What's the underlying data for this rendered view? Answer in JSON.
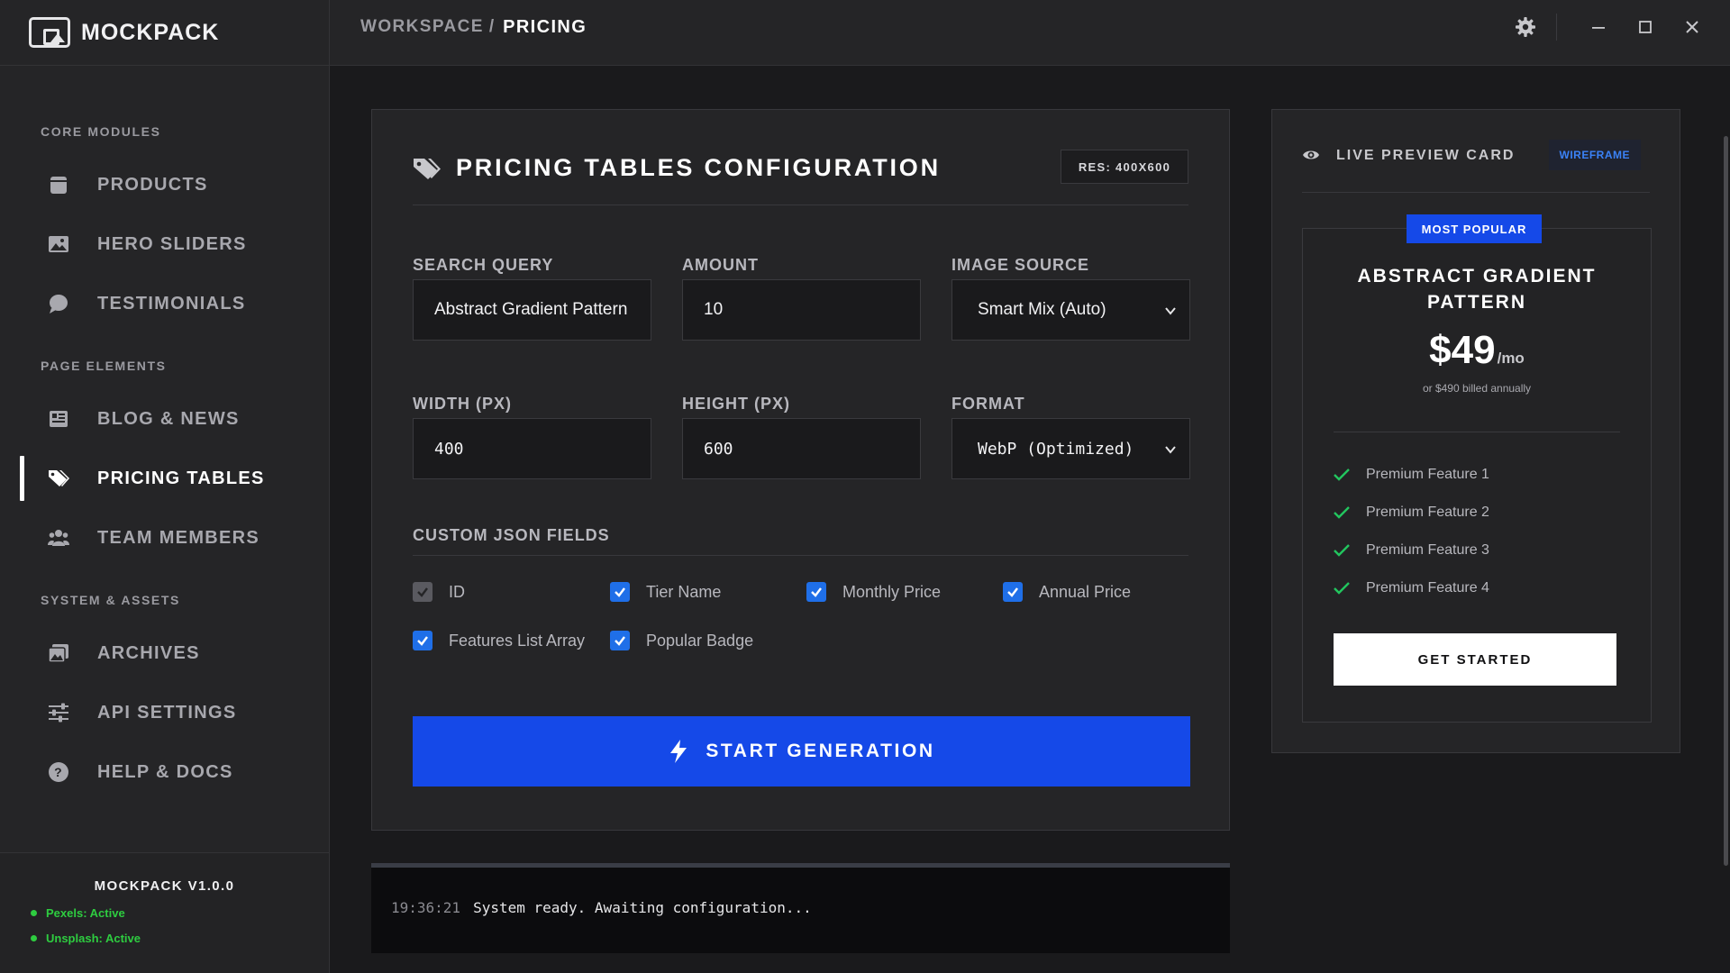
{
  "app": {
    "name": "MOCKPACK",
    "version": "MOCKPACK V1.0.0"
  },
  "sidebar": {
    "sections": [
      {
        "title": "CORE MODULES",
        "items": [
          {
            "label": "PRODUCTS",
            "icon": "box-icon"
          },
          {
            "label": "HERO SLIDERS",
            "icon": "image-icon"
          },
          {
            "label": "TESTIMONIALS",
            "icon": "chat-bubble-icon"
          }
        ]
      },
      {
        "title": "PAGE ELEMENTS",
        "items": [
          {
            "label": "BLOG & NEWS",
            "icon": "newspaper-icon"
          },
          {
            "label": "PRICING TABLES",
            "icon": "tags-icon",
            "active": true
          },
          {
            "label": "TEAM MEMBERS",
            "icon": "users-icon"
          }
        ]
      },
      {
        "title": "SYSTEM & ASSETS",
        "items": [
          {
            "label": "ARCHIVES",
            "icon": "images-icon"
          },
          {
            "label": "API SETTINGS",
            "icon": "sliders-icon"
          },
          {
            "label": "HELP & DOCS",
            "icon": "help-circle-icon"
          }
        ]
      }
    ],
    "status": [
      {
        "text": "Pexels: Active"
      },
      {
        "text": "Unsplash: Active"
      }
    ]
  },
  "header": {
    "breadcrumb_parent": "WORKSPACE",
    "breadcrumb_sep": "/",
    "breadcrumb_current": "PRICING"
  },
  "config": {
    "title": "PRICING TABLES CONFIGURATION",
    "resolution_badge": "RES: 400X600",
    "search_label": "SEARCH QUERY",
    "search_value": "Abstract Gradient Pattern",
    "amount_label": "AMOUNT",
    "amount_value": "10",
    "source_label": "IMAGE SOURCE",
    "source_value": "Smart Mix (Auto)",
    "width_label": "WIDTH (PX)",
    "width_value": "400",
    "height_label": "HEIGHT (PX)",
    "height_value": "600",
    "format_label": "FORMAT",
    "format_value": "WebP (Optimized)",
    "json_label": "CUSTOM JSON FIELDS",
    "fields": {
      "id": "ID",
      "tier_name": "Tier Name",
      "monthly_price": "Monthly Price",
      "annual_price": "Annual Price",
      "features_list": "Features List Array",
      "popular_badge": "Popular Badge"
    },
    "generate_label": "START GENERATION"
  },
  "console": {
    "time": "19:36:21",
    "message": "System ready. Awaiting configuration..."
  },
  "preview": {
    "title": "LIVE PREVIEW CARD",
    "mode_badge": "WIREFRAME",
    "popular_badge": "MOST POPULAR",
    "tier_name": "ABSTRACT GRADIENT PATTERN",
    "price": "$49",
    "period": "/mo",
    "annual_note": "or $490 billed annually",
    "features": [
      "Premium Feature 1",
      "Premium Feature 2",
      "Premium Feature 3",
      "Premium Feature 4"
    ],
    "cta_label": "GET STARTED"
  },
  "colors": {
    "accent": "#1549e8",
    "checkbox": "#1f6fe8",
    "status_green": "#2ecc40",
    "check_green": "#22c55e"
  }
}
